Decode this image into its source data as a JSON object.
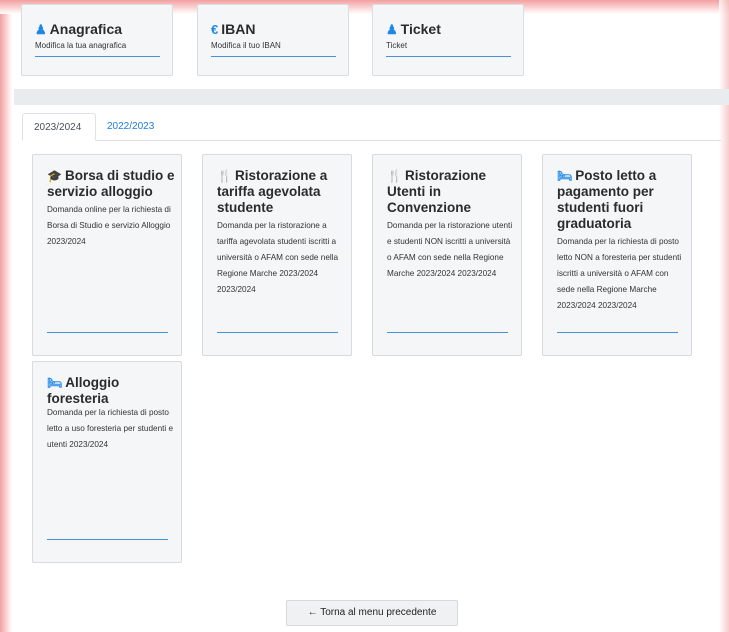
{
  "top_cards": [
    {
      "icon": "user-icon",
      "title": "Anagrafica",
      "subtitle": "Modifica la tua anagrafica"
    },
    {
      "icon": "euro-icon",
      "title": "IBAN",
      "subtitle": "Modifica il tuo IBAN"
    },
    {
      "icon": "user-icon",
      "title": "Ticket",
      "subtitle": "Ticket"
    }
  ],
  "tabs": [
    {
      "label": "2023/2024",
      "active": true
    },
    {
      "label": "2022/2023",
      "active": false
    }
  ],
  "service_cards": [
    {
      "icon": "graduation-cap-icon",
      "title": "Borsa di studio e servizio alloggio",
      "description": "Domanda online per la richiesta di Borsa di Studio e servizio Alloggio 2023/2024"
    },
    {
      "icon": "utensils-icon",
      "title": "Ristorazione a tariffa agevolata studente",
      "description": "Domanda per la ristorazione a tariffa agevolata studenti iscritti a università o AFAM con sede nella Regione Marche 2023/2024 2023/2024"
    },
    {
      "icon": "utensils-icon",
      "title": "Ristorazione Utenti in Convenzione",
      "description": "Domanda per la ristorazione utenti e studenti NON iscritti a università o AFAM con sede nella Regione Marche 2023/2024 2023/2024"
    },
    {
      "icon": "bed-icon",
      "title": "Posto letto a pagamento per studenti fuori graduatoria",
      "description": "Domanda per la richiesta di posto letto NON a foresteria per studenti iscritti a università o AFAM con sede nella Regione Marche 2023/2024 2023/2024"
    },
    {
      "icon": "bed-icon",
      "title": "Alloggio foresteria",
      "description": "Domanda per la richiesta di posto letto a uso foresteria per studenti e utenti 2023/2024"
    }
  ],
  "back_button": {
    "arrow": "←",
    "label": "Torna al menu precedente"
  },
  "colors": {
    "accent": "#1e88e5",
    "link": "#1e7ce0",
    "card_bg": "#f5f6f8"
  }
}
